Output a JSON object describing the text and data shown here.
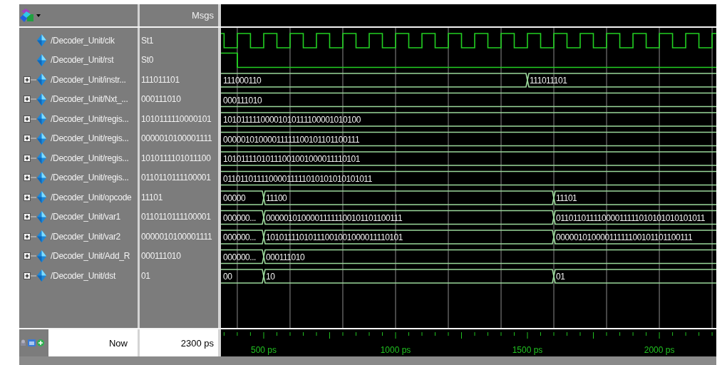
{
  "header": {
    "values_title": "Msgs"
  },
  "signals": [
    {
      "name": "/Decoder_Unit/clk",
      "value": "St1",
      "expandable": false,
      "kind": "clock"
    },
    {
      "name": "/Decoder_Unit/rst",
      "value": "St0",
      "expandable": false,
      "kind": "bit",
      "segments": [
        {
          "high": true
        },
        {
          "high": false
        }
      ]
    },
    {
      "name": "/Decoder_Unit/instr...",
      "value": "111011101",
      "expandable": true,
      "kind": "bus",
      "segments": [
        {
          "text": "111000110"
        },
        {
          "text": "111011101"
        }
      ]
    },
    {
      "name": "/Decoder_Unit/Nxt_...",
      "value": "000111010",
      "expandable": true,
      "kind": "bus",
      "segments": [
        {
          "text": "000111010"
        }
      ]
    },
    {
      "name": "/Decoder_Unit/regis...",
      "value": "1010111110000101",
      "expandable": true,
      "kind": "bus",
      "segments": [
        {
          "text": "10101111100001010111100001010100"
        }
      ]
    },
    {
      "name": "/Decoder_Unit/regis...",
      "value": "0000010100001111",
      "expandable": true,
      "kind": "bus",
      "segments": [
        {
          "text": "00000101000011111100101101100111"
        }
      ]
    },
    {
      "name": "/Decoder_Unit/regis...",
      "value": "1010111101011100",
      "expandable": true,
      "kind": "bus",
      "segments": [
        {
          "text": "10101111010111001001000011110101"
        }
      ]
    },
    {
      "name": "/Decoder_Unit/regis...",
      "value": "0110110111100001",
      "expandable": true,
      "kind": "bus",
      "segments": [
        {
          "text": "01101101111000011111010101010101011"
        }
      ]
    },
    {
      "name": "/Decoder_Unit/opcode",
      "value": "11101",
      "expandable": true,
      "kind": "bus",
      "segments": [
        {
          "text": "00000"
        },
        {
          "text": "11100"
        },
        {
          "text": "11101"
        }
      ]
    },
    {
      "name": "/Decoder_Unit/var1",
      "value": "0110110111100001",
      "expandable": true,
      "kind": "bus",
      "segments": [
        {
          "text": "000000..."
        },
        {
          "text": "00000101000011111100101101100111"
        },
        {
          "text": "01101101111000011111010101010101011"
        }
      ]
    },
    {
      "name": "/Decoder_Unit/var2",
      "value": "0000010100001111",
      "expandable": true,
      "kind": "bus",
      "segments": [
        {
          "text": "000000..."
        },
        {
          "text": "10101111010111001001000011110101"
        },
        {
          "text": "00000101000011111100101101100111"
        }
      ]
    },
    {
      "name": "/Decoder_Unit/Add_R",
      "value": "000111010",
      "expandable": true,
      "kind": "bus",
      "segments": [
        {
          "text": "000000..."
        },
        {
          "text": "000111010"
        }
      ]
    },
    {
      "name": "/Decoder_Unit/dst",
      "value": "01",
      "expandable": true,
      "kind": "bus",
      "segments": [
        {
          "text": "00"
        },
        {
          "text": "10"
        },
        {
          "text": "01"
        }
      ]
    }
  ],
  "footer": {
    "now_label": "Now",
    "now_time": "2300 ps"
  },
  "time_axis": {
    "labels": [
      "500 ps",
      "1000 ps",
      "1500 ps",
      "2000 ps"
    ]
  }
}
